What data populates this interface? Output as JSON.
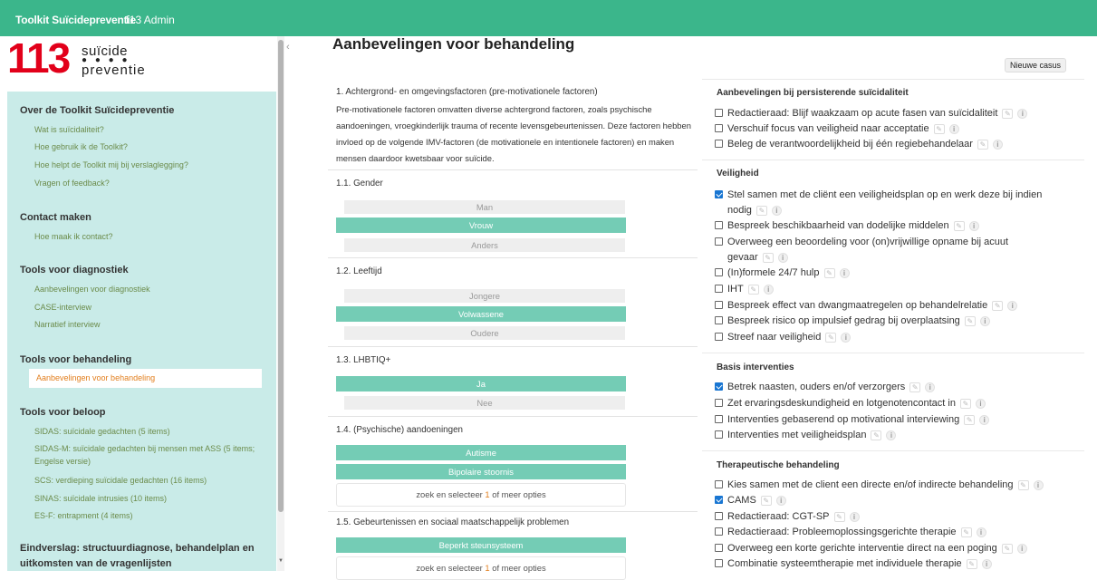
{
  "topbar": {
    "brand": "Toolkit Suïcidepreventie",
    "admin": "113 Admin"
  },
  "logo": {
    "number": "113",
    "word1": "suïcide",
    "dots": "● ● ● ●",
    "word2": "preventie"
  },
  "nav": {
    "sections": [
      {
        "title": "Over de Toolkit Suïcidepreventie",
        "items": [
          "Wat is suïcidaliteit?",
          "Hoe gebruik ik de Toolkit?",
          "Hoe helpt de Toolkit mij bij verslaglegging?",
          "Vragen of feedback?"
        ]
      },
      {
        "title": "Contact maken",
        "items": [
          "Hoe maak ik contact?"
        ]
      },
      {
        "title": "Tools voor diagnostiek",
        "items": [
          "Aanbevelingen voor diagnostiek",
          "CASE-interview",
          "Narratief interview"
        ]
      },
      {
        "title": "Tools voor behandeling",
        "items": [
          "Aanbevelingen voor behandeling"
        ]
      },
      {
        "title": "Tools voor beloop",
        "items": [
          "SIDAS: suïcidale gedachten (5 items)",
          "SIDAS-M: suïcidale gedachten bij mensen met ASS (5 items; Engelse versie)",
          "SCS: verdieping suïcidale gedachten (16 items)",
          "SINAS: suïcidale intrusies (10 items)",
          "ES-F: entrapment (4 items)"
        ]
      },
      {
        "title": "Eindverslag: structuurdiagnose, behandelplan en uitkomsten van de vragenlijsten",
        "items": []
      }
    ]
  },
  "collapse_icon": "‹",
  "page_title": "Aanbevelingen voor behandeling",
  "new_case_label": "Nieuwe casus",
  "factors": {
    "heading": "1. Achtergrond- en omgevingsfactoren (pre-motivationele factoren)",
    "intro": "Pre-motivationele factoren omvatten diverse achtergrond factoren, zoals psychische aandoeningen, vroegkinderlijk trauma of recente levensgebeurtenissen. Deze factoren hebben invloed op de volgende IMV-factoren (de motivationele en intentionele factoren) en maken mensen daardoor kwetsbaar voor suïcide.",
    "gender": {
      "title": "1.1. Gender",
      "options": [
        "Man",
        "Vrouw",
        "Anders"
      ]
    },
    "age": {
      "title": "1.2. Leeftijd",
      "options": [
        "Jongere",
        "Volwassene",
        "Oudere"
      ]
    },
    "lhbtiq": {
      "title": "1.3. LHBTIQ+",
      "options": [
        "Ja",
        "Nee"
      ]
    },
    "conditions": {
      "title": "1.4. (Psychische) aandoeningen",
      "selected": [
        "Autisme",
        "Bipolaire stoornis"
      ]
    },
    "events": {
      "title": "1.5. Gebeurtenissen en sociaal maatschappelijk problemen",
      "selected": [
        "Beperkt steunsysteem"
      ]
    },
    "search_prefix": "zoek en selecteer",
    "search_count": "1",
    "search_suffix": "of meer opties"
  },
  "panels": {
    "persistent": {
      "title": "Aanbevelingen bij persisterende suïcidaliteit",
      "items": [
        "Redactieraad: Blijf waakzaam op acute fasen van suïcidaliteit",
        "Verschuif focus van veiligheid naar acceptatie",
        "Beleg de verantwoordelijkheid bij één regiebehandelaar"
      ]
    },
    "safety": {
      "title": "Veiligheid",
      "items": [
        "Stel samen met de cliënt een veiligheidsplan op en werk deze bij indien",
        "nodig",
        "Bespreek beschikbaarheid van dodelijke middelen",
        "Overweeg een beoordeling voor (on)vrijwillige opname bij acuut",
        "gevaar",
        "(In)formele 24/7 hulp",
        "IHT",
        "Bespreek effect van dwangmaatregelen op behandelrelatie",
        "Bespreek risico op impulsief gedrag bij overplaatsing",
        "Streef naar veiligheid"
      ]
    },
    "basic": {
      "title": "Basis interventies",
      "items": [
        "Betrek naasten, ouders en/of verzorgers",
        "Zet ervaringsdeskundigheid en lotgenotencontact in",
        "Interventies gebaserend op motivational interviewing",
        "Interventies met veiligheidsplan"
      ]
    },
    "therapy": {
      "title": "Therapeutische behandeling",
      "items": [
        "Kies samen met de client een directe en/of indirecte behandeling",
        "CAMS",
        "Redactieraad: CGT-SP",
        "Redactieraad: Probleemoplossingsgerichte therapie",
        "Overweeg een korte gerichte interventie direct na een poging",
        "Combinatie systeemtherapie met individuele therapie"
      ]
    }
  },
  "icons": {
    "edit": "✎",
    "info": "i"
  },
  "colors": {
    "accent": "#3bb68b",
    "selected_option": "#74ccb5",
    "nav_bg": "#c9ebe8",
    "logo_red": "#e2001a",
    "link": "#6b8b4a",
    "active_link": "#e27e1d"
  }
}
